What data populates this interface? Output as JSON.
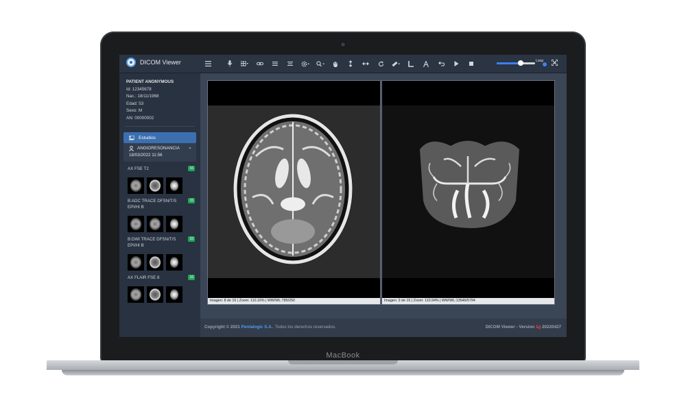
{
  "laptop": {
    "brand": "MacBook"
  },
  "app": {
    "title": "DICOM Viewer"
  },
  "toolbar": {
    "icons": [
      "menu-icon",
      "mic-icon",
      "grid-layout-icon",
      "link-icon",
      "list-icon",
      "align-icon",
      "settings-icon",
      "zoom-icon",
      "pan-hand-icon",
      "scroll-vertical-icon",
      "scroll-horizontal-icon",
      "rotate-icon",
      "measure-icon",
      "angle-icon",
      "text-annotation-icon",
      "undo-icon",
      "play-icon",
      "stop-icon",
      "fullscreen-icon"
    ],
    "loop_label": "Loop",
    "loop_checked": true,
    "slider_value": 0.6
  },
  "patient": {
    "name": "PATIENT ANONYMOUS",
    "id": "Id: 12345678",
    "birth": "Nac.: 18/11/1968",
    "age": "Edad: 53",
    "sex": "Sexo: M",
    "an": "AN: 00000002"
  },
  "sidebar": {
    "tab_label": "Estudios",
    "study": {
      "name": "ANGIORESONANCIA",
      "date": "18/03/2022 11:56"
    },
    "series": [
      {
        "name": "AX FSE T2",
        "count": "16"
      },
      {
        "name": "B:ADC TRACE DFSN/T/S",
        "sub": "EPI/HI B",
        "count": "15"
      },
      {
        "name": "B:DWI TRACE DFSN/T/S",
        "sub": "EPI/HI B",
        "count": "15"
      },
      {
        "name": "AX FLAIR FSE 8",
        "count": "16"
      }
    ]
  },
  "viewports": {
    "left_info": "Imagen: 8 de 16 | Zoom: 110.16% | WW/WL:785/250",
    "right_info": "Imagen: 3 de 15 | Zoom: 110.94% | WW/WL:13546/5794"
  },
  "footer": {
    "copyright_prefix": "Copyright © 2021",
    "company": "Pentalogic S.A.",
    "rights": ". Todos los derechos reservados.",
    "version_prefix": "DICOM Viewer - Version",
    "version_mark": "1g",
    "version_number": "20220427"
  },
  "colors": {
    "accent": "#3b6fb0",
    "badge": "#22a35a",
    "link": "#4f9df0"
  }
}
